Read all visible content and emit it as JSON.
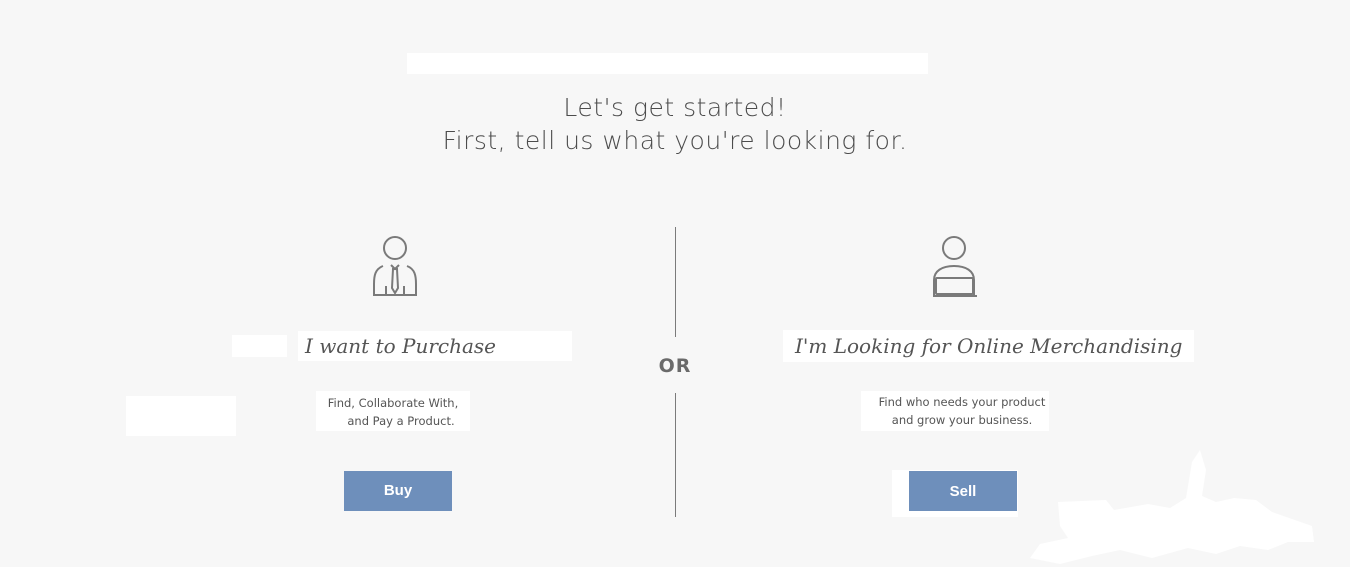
{
  "heading": {
    "line1": "Let's get started!",
    "line2": "First, tell us what you're looking for."
  },
  "separator": {
    "label": "OR"
  },
  "buy_option": {
    "icon": "buyer-person-tie-icon",
    "title": "I want to Purchase",
    "description_line1": "Find, Collaborate With,",
    "description_line2": "and Pay a Product.",
    "button_label": "Buy"
  },
  "sell_option": {
    "icon": "seller-person-laptop-icon",
    "title": "I'm Looking for Online Merchandising",
    "description_line1": "Find who needs your product",
    "description_line2": "and grow your business.",
    "button_label": "Sell"
  },
  "colors": {
    "background": "#f7f7f7",
    "button": "#6e8fbb",
    "text": "#4a4a4a",
    "divider": "#7b7b7b"
  }
}
